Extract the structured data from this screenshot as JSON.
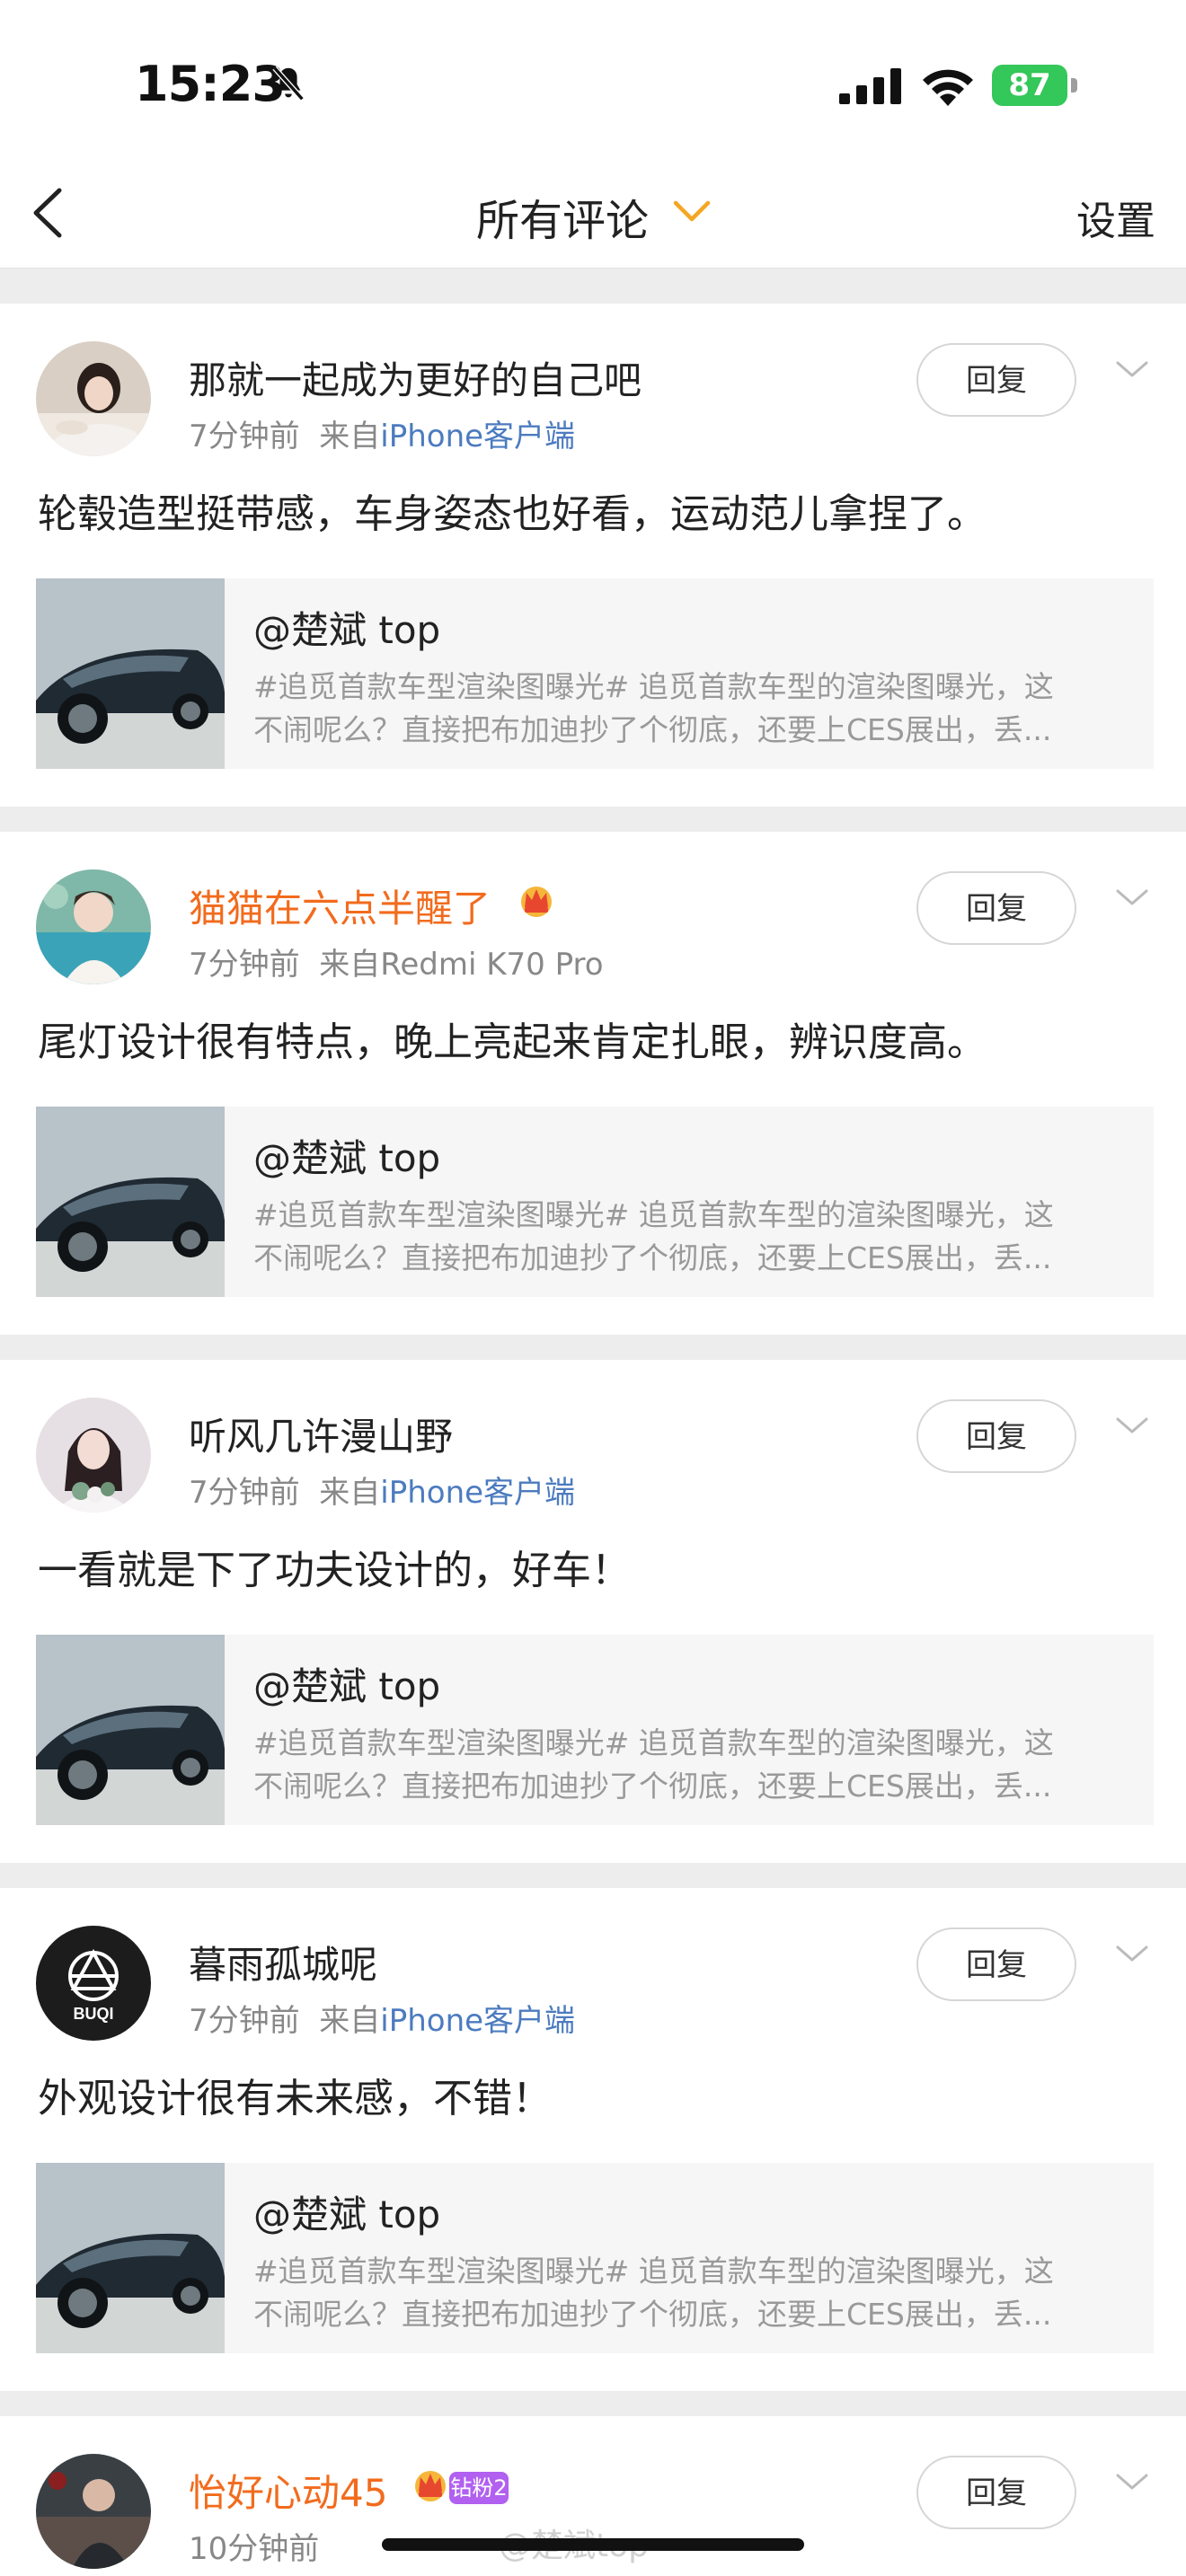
{
  "status_bar": {
    "time": "15:23",
    "battery": "87"
  },
  "nav": {
    "title": "所有评论",
    "settings": "设置"
  },
  "reply_label": "回复",
  "comments": [
    {
      "username": "那就一起成为更好的自己吧",
      "vip": false,
      "time": "7分钟前",
      "from_prefix": "来自",
      "source": "iPhone客户端",
      "source_link": true,
      "text": "轮毂造型挺带感，车身姿态也好看，运动范儿拿捏了。",
      "quote_author": "@楚斌 top",
      "quote_line1": "#追觅首款车型渲染图曝光#  追觅首款车型的渲染图曝光，这",
      "quote_line2": "不闹呢么？直接把布加迪抄了个彻底，还要上CES展出，丢..."
    },
    {
      "username": "猫猫在六点半醒了",
      "vip": true,
      "time": "7分钟前",
      "from_prefix": "来自",
      "source": "Redmi K70 Pro",
      "source_link": false,
      "text": "尾灯设计很有特点，晚上亮起来肯定扎眼，辨识度高。",
      "quote_author": "@楚斌 top",
      "quote_line1": "#追觅首款车型渲染图曝光#  追觅首款车型的渲染图曝光，这",
      "quote_line2": "不闹呢么？直接把布加迪抄了个彻底，还要上CES展出，丢..."
    },
    {
      "username": "听风几许漫山野",
      "vip": false,
      "time": "7分钟前",
      "from_prefix": "来自",
      "source": "iPhone客户端",
      "source_link": true,
      "text": "一看就是下了功夫设计的，好车！",
      "quote_author": "@楚斌 top",
      "quote_line1": "#追觅首款车型渲染图曝光#  追觅首款车型的渲染图曝光，这",
      "quote_line2": "不闹呢么？直接把布加迪抄了个彻底，还要上CES展出，丢..."
    },
    {
      "username": "暮雨孤城呢",
      "vip": false,
      "time": "7分钟前",
      "from_prefix": "来自",
      "source": "iPhone客户端",
      "source_link": true,
      "text": "外观设计很有未来感，不错！",
      "quote_author": "@楚斌 top",
      "quote_line1": "#追觅首款车型渲染图曝光#  追觅首款车型的渲染图曝光，这",
      "quote_line2": "不闹呢么？直接把布加迪抄了个彻底，还要上CES展出，丢..."
    },
    {
      "username": "怡好心动45",
      "vip": true,
      "fan_badge": "钻粉2",
      "time": "10分钟前"
    }
  ],
  "avatar4_text": "BUQI",
  "watermark": "@楚斌top",
  "colors": {
    "vip_name": "#f26b1d",
    "source_link": "#4c7bbf",
    "battery": "#34c759",
    "fan_badge": "#b160f0"
  }
}
